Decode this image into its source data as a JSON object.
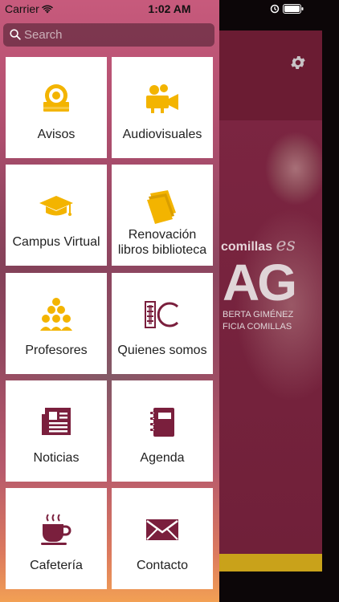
{
  "status_bar": {
    "carrier": "Carrier",
    "time": "1:02 AM"
  },
  "search": {
    "placeholder": "Search"
  },
  "menu": {
    "items": [
      {
        "label": "Avisos",
        "icon": "alarm-bell-icon",
        "color": "#f3b400"
      },
      {
        "label": "Audiovisuales",
        "icon": "video-camera-icon",
        "color": "#f3b400"
      },
      {
        "label": "Campus Virtual",
        "icon": "graduation-cap-icon",
        "color": "#f3b400"
      },
      {
        "label": "Renovación libros biblioteca",
        "icon": "books-icon",
        "color": "#f3b400"
      },
      {
        "label": "Profesores",
        "icon": "people-group-icon",
        "color": "#f3b400"
      },
      {
        "label": "Quienes somos",
        "icon": "ic-logo-icon",
        "color": "#7a1f3d"
      },
      {
        "label": "Noticias",
        "icon": "newspaper-icon",
        "color": "#7a1f3d"
      },
      {
        "label": "Agenda",
        "icon": "notebook-icon",
        "color": "#7a1f3d"
      },
      {
        "label": "Cafetería",
        "icon": "coffee-cup-icon",
        "color": "#7a1f3d"
      },
      {
        "label": "Contacto",
        "icon": "envelope-icon",
        "color": "#7a1f3d"
      }
    ]
  },
  "background": {
    "brand_text": "comillas",
    "brand_script": "es",
    "logo_letters": "AG",
    "subtitle_1": "BERTA GIMÉNEZ",
    "subtitle_2": "FICIA COMILLAS",
    "accent_color": "#7a1f3d",
    "bar_color": "#c9a21a"
  }
}
